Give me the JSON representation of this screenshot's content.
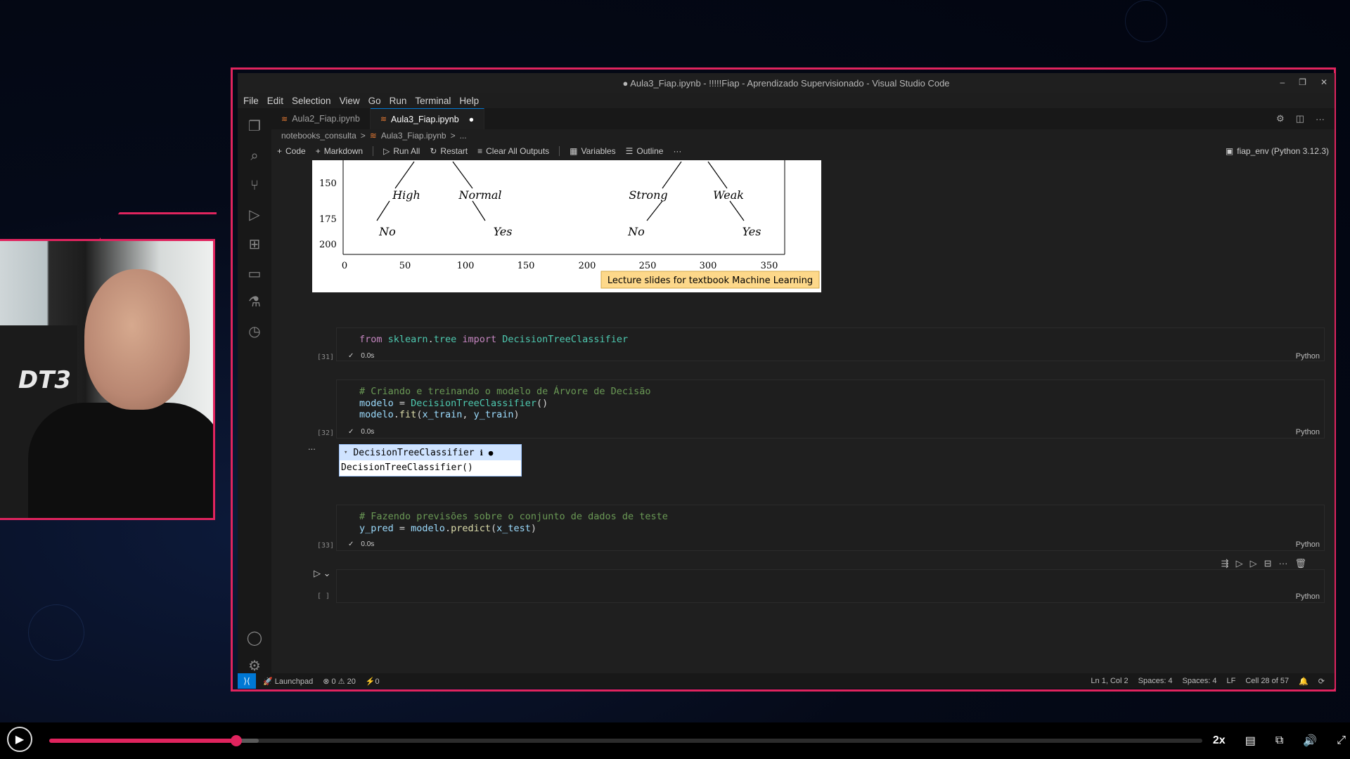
{
  "window": {
    "title": "● Aula3_Fiap.ipynb - !!!!!Fiap - Aprendizado Supervisionado - Visual Studio Code"
  },
  "menu": [
    "File",
    "Edit",
    "Selection",
    "View",
    "Go",
    "Run",
    "Terminal",
    "Help"
  ],
  "tabs": [
    {
      "label": "Aula2_Fiap.ipynb"
    },
    {
      "label": "Aula3_Fiap.ipynb",
      "dirty": "●"
    }
  ],
  "breadcrumb": [
    "notebooks_consulta",
    ">",
    "Aula3_Fiap.ipynb",
    ">",
    "..."
  ],
  "toolbar": {
    "code": "Code",
    "markdown": "Markdown",
    "run_all": "Run All",
    "restart": "Restart",
    "clear": "Clear All Outputs",
    "variables": "Variables",
    "outline": "Outline",
    "more": "···",
    "kernel": "fiap_env (Python 3.12.3)"
  },
  "image_output": {
    "y_ticks": [
      "150",
      "175",
      "200"
    ],
    "x_ticks": [
      "0",
      "50",
      "100",
      "150",
      "200",
      "250",
      "300",
      "350"
    ],
    "nodes": [
      "High",
      "Normal",
      "Strong",
      "Weak"
    ],
    "leaves": [
      "No",
      "Yes",
      "No",
      "Yes"
    ],
    "caption": "Lecture slides for textbook Machine Learning"
  },
  "cells": [
    {
      "count": "[31]",
      "time": "0.0s",
      "lang": "Python"
    },
    {
      "count": "[32]",
      "time": "0.0s",
      "lang": "Python",
      "comment": "# Criando e treinando o modelo de Árvore de Decisão"
    },
    {
      "count": "[33]",
      "time": "0.0s",
      "lang": "Python",
      "comment": "# Fazendo previsões sobre o conjunto de dados de teste"
    },
    {
      "count": "[ ]",
      "lang": "Python"
    }
  ],
  "widget": {
    "title": "DecisionTreeClassifier",
    "body": "DecisionTreeClassifier()",
    "ellipsis": "..."
  },
  "statusbar": {
    "launchpad": "Launchpad",
    "errors": "⊗ 0 ⚠ 20",
    "ports": "⚡0",
    "position": "Ln 1, Col 2",
    "spaces1": "Spaces: 4",
    "spaces2": "Spaces: 4",
    "eol": "LF",
    "cell": "Cell 28 of 57"
  },
  "player": {
    "progress": 0.162,
    "buffered": 0.182,
    "speed": "2x"
  },
  "colors": {
    "accent": "#e0245e",
    "vscode_blue": "#0078d4"
  }
}
